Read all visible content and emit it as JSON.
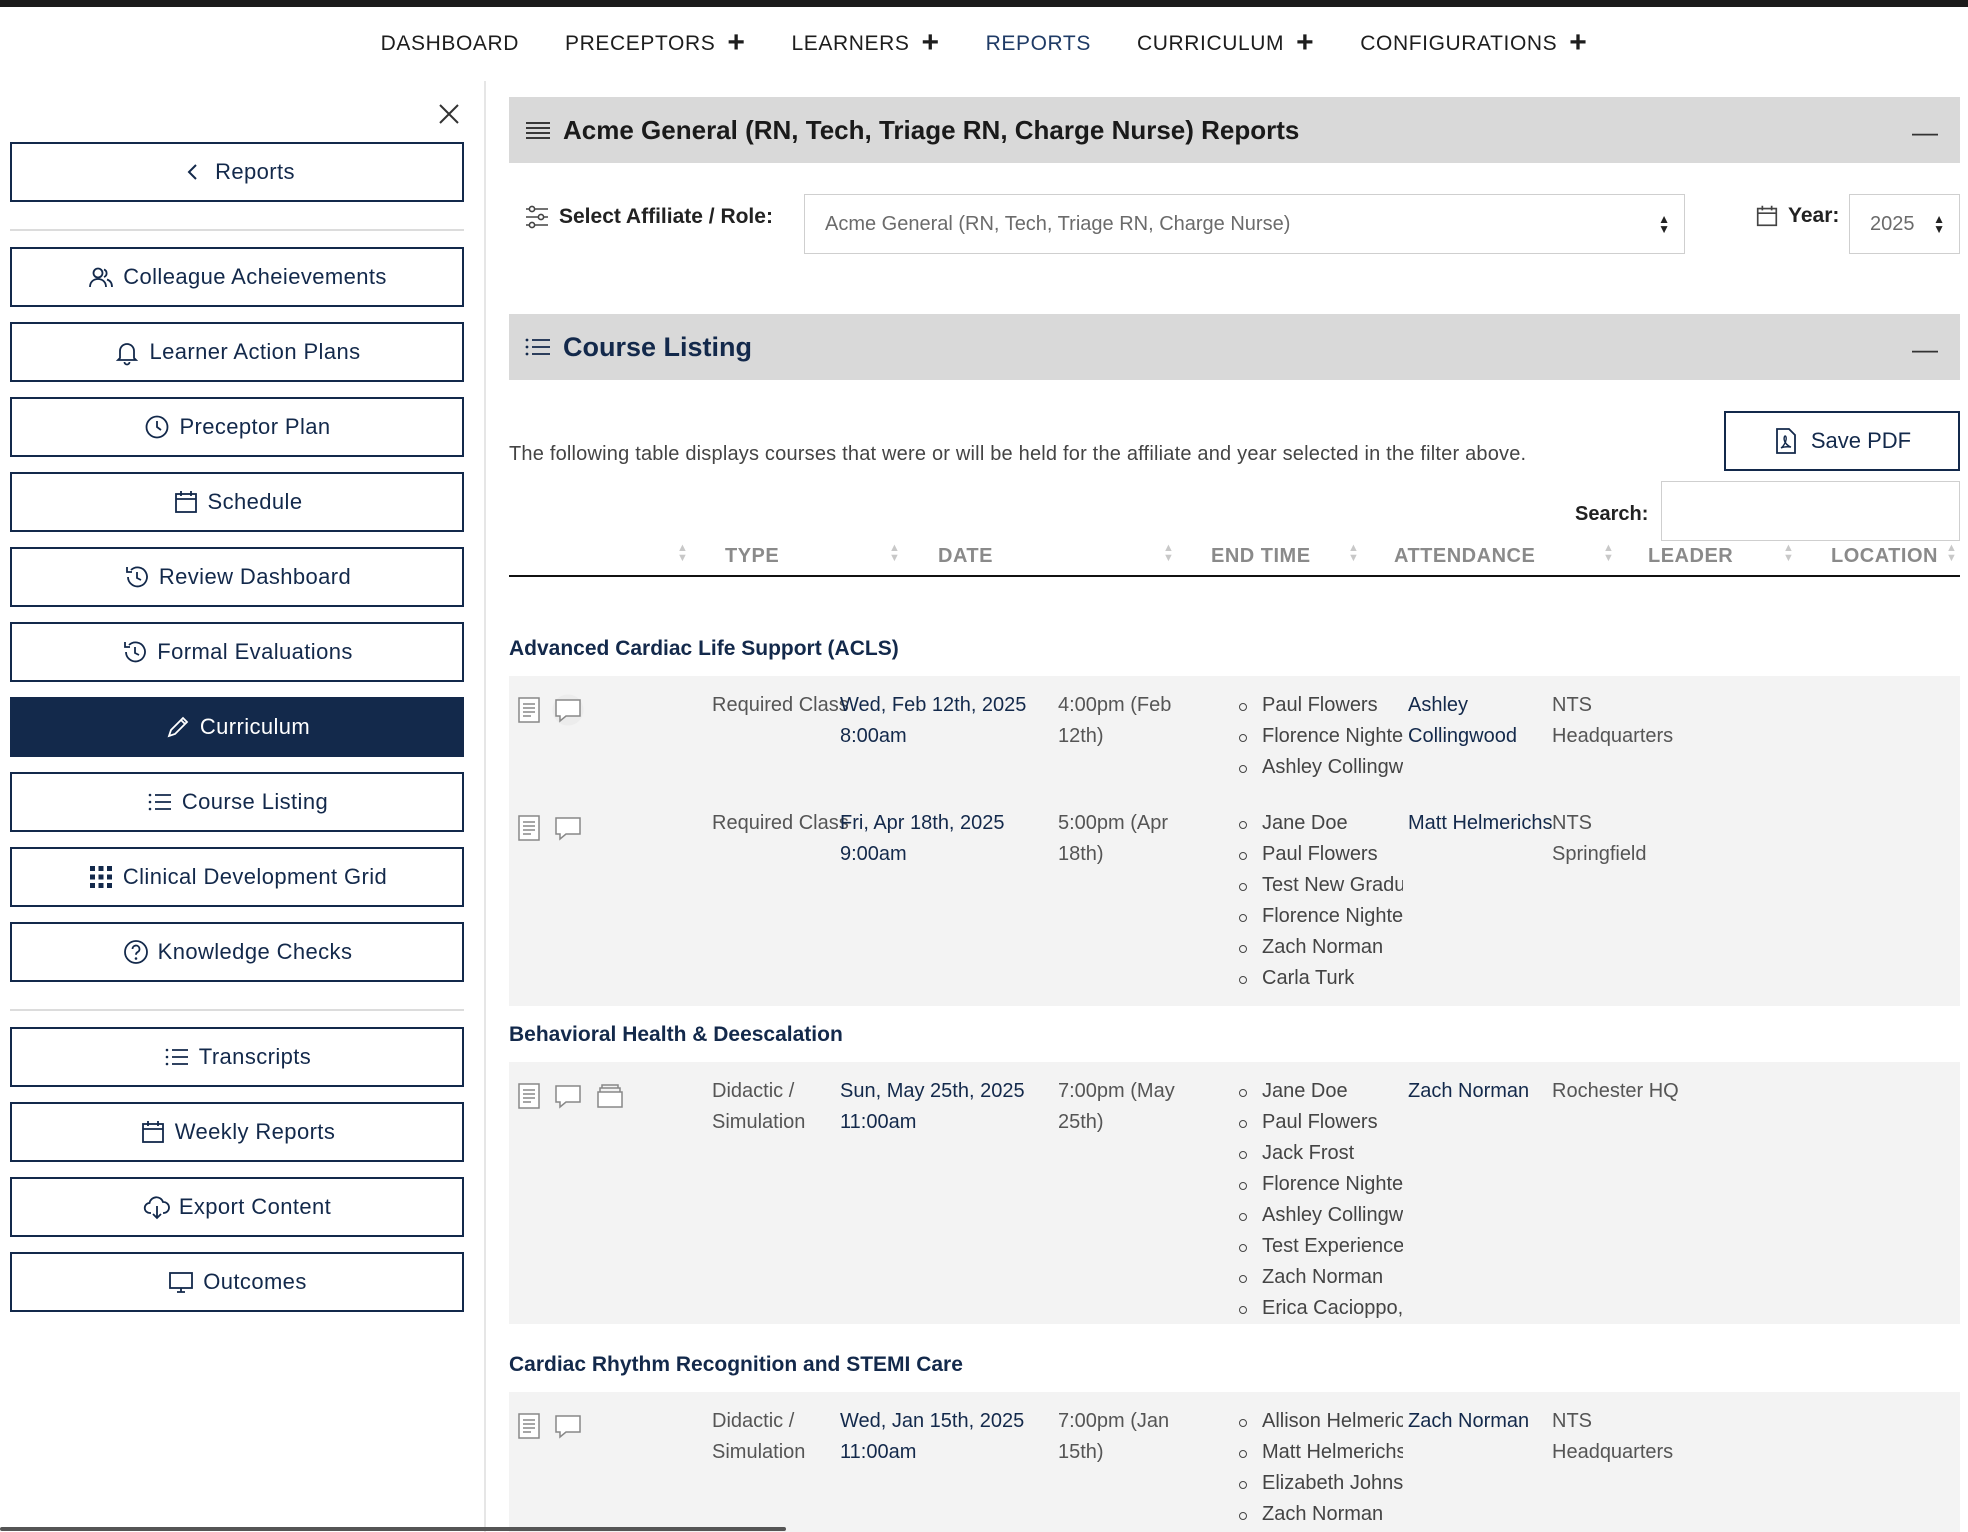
{
  "topnav": [
    {
      "label": "DASHBOARD",
      "has_plus": false
    },
    {
      "label": "PRECEPTORS",
      "has_plus": true
    },
    {
      "label": "LEARNERS",
      "has_plus": true
    },
    {
      "label": "REPORTS",
      "has_plus": false
    },
    {
      "label": "CURRICULUM",
      "has_plus": true
    },
    {
      "label": "CONFIGURATIONS",
      "has_plus": true
    }
  ],
  "sidebar": {
    "back_label": "Reports",
    "items": [
      {
        "label": "Colleague Acheievements",
        "icon": "users-icon"
      },
      {
        "label": "Learner Action Plans",
        "icon": "bell-icon"
      },
      {
        "label": "Preceptor Plan",
        "icon": "clock-icon"
      },
      {
        "label": "Schedule",
        "icon": "calendar-icon"
      },
      {
        "label": "Review Dashboard",
        "icon": "history-icon"
      },
      {
        "label": "Formal Evaluations",
        "icon": "history-icon"
      },
      {
        "label": "Curriculum",
        "icon": "pencil-icon",
        "active": true
      },
      {
        "label": "Course Listing",
        "icon": "list-icon"
      },
      {
        "label": "Clinical Development Grid",
        "icon": "grid-icon"
      },
      {
        "label": "Knowledge Checks",
        "icon": "question-icon"
      }
    ],
    "items2": [
      {
        "label": "Transcripts",
        "icon": "list-icon"
      },
      {
        "label": "Weekly Reports",
        "icon": "calendar-icon"
      },
      {
        "label": "Export Content",
        "icon": "cloud-download-icon"
      },
      {
        "label": "Outcomes",
        "icon": "monitor-icon"
      }
    ]
  },
  "reports_panel": {
    "title": "Acme General (RN, Tech, Triage RN, Charge Nurse) Reports",
    "affiliate_label": "Select Affiliate / Role:",
    "affiliate_value": "Acme General (RN, Tech, Triage RN, Charge Nurse)",
    "year_label": "Year:",
    "year_value": "2025"
  },
  "course_panel": {
    "title": "Course Listing",
    "description": "The following table displays courses that were or will be held for the affiliate and year selected in the filter above.",
    "save_pdf_label": "Save PDF",
    "search_label": "Search:",
    "search_value": "",
    "columns": [
      "TYPE",
      "DATE",
      "END TIME",
      "ATTENDANCE",
      "LEADER",
      "LOCATION"
    ]
  },
  "groups": [
    {
      "title": "Advanced Cardiac Life Support (ACLS)",
      "rows": [
        {
          "icons": [
            "document-icon",
            "comment-icon"
          ],
          "type": "Required Class",
          "date": "Wed, Feb 12th, 2025 8:00am",
          "end_time": "4:00pm (Feb 12th)",
          "attendance": [
            "Paul Flowers",
            "Florence Nightengale",
            "Ashley Collingwood"
          ],
          "leader": "Ashley Collingwood",
          "location": "NTS Headquarters"
        },
        {
          "icons": [
            "document-icon",
            "comment-icon"
          ],
          "type": "Required Class",
          "date": "Fri, Apr 18th, 2025 9:00am",
          "end_time": "5:00pm (Apr 18th)",
          "attendance": [
            "Jane Doe",
            "Paul Flowers",
            "Test New Graduate",
            "Florence Nightengale",
            "Zach Norman",
            "Carla Turk"
          ],
          "leader": "Matt Helmerichs",
          "location": "NTS Springfield"
        }
      ]
    },
    {
      "title": "Behavioral Health & Deescalation",
      "rows": [
        {
          "icons": [
            "document-icon",
            "comment-icon",
            "archive-icon"
          ],
          "type": "Didactic / Simulation",
          "date": "Sun, May 25th, 2025 11:00am",
          "end_time": "7:00pm (May 25th)",
          "attendance": [
            "Jane Doe",
            "Paul Flowers",
            "Jack Frost",
            "Florence Nightengale",
            "Ashley Collingwood",
            "Test Experienced RN",
            "Zach Norman",
            "Erica Cacioppo, Dr."
          ],
          "leader": "Zach Norman",
          "location": "Rochester HQ"
        }
      ]
    },
    {
      "title": "Cardiac Rhythm Recognition and STEMI Care",
      "rows": [
        {
          "icons": [
            "document-icon",
            "comment-icon"
          ],
          "type": "Didactic / Simulation",
          "date": "Wed, Jan 15th, 2025 11:00am",
          "end_time": "7:00pm (Jan 15th)",
          "attendance": [
            "Allison Helmerichs",
            "Matt Helmerichs",
            "Elizabeth Johnson",
            "Zach Norman"
          ],
          "leader": "Zach Norman",
          "location": "NTS Headquarters"
        }
      ]
    }
  ]
}
